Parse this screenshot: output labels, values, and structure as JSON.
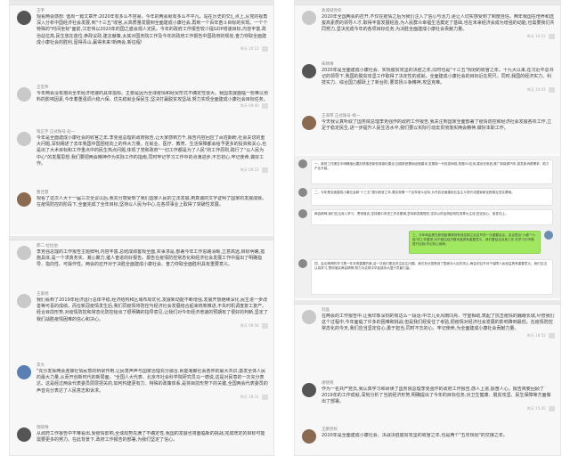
{
  "left": {
    "s1": {
      "items": [
        {
          "user": "王宇",
          "text": "观看两会感想:\n值周一篇文章开:2020年有多么不容易。今年的两会就有多么不平凡。站在历史的交汇点上,从党的视角深入分析中国经济社会发展,到\"十三五\"收官,从高质量发展到全面建成小康社会,再到一个百年奋斗目标的实现。一个个特殊的\"时间坐标\"面前,江宏伟以2020年的国之盛会观人定民。今年的政府工作报告较少提GDP增速目标,内容丰富,政治站位高,民生放在首位,参政议政,建言献策,太其对国务院工作及今年的政府工作报告中国政府的规划,奋力夺取全面建成小康社会的胜利,留得青山,赢得未来!新两会,新征程!",
          "time": "昨天 10:12"
        },
        {
          "user": "王宏伟",
          "text": "今年两会没有抱出全年经济增速的具体指标。主要是因为全球疫情和经贸形式不确定性很大。我国发展面临一些难以预料的影响因素,今年着重强调六稳六保。优先稳就业保民生,坚决打赢脱贫攻坚战,努力实现全面建成小康社会目标任务。",
          "time": "昨天 09:40"
        },
        {
          "user": "钱正宇 正式账号·赵一",
          "text": "今年是全面建成小康社会的收官之年,李克强总理的政府报告,让大家感到万千,报告内容回应了百姓期盼,社会关切的重大问题,深刻阐述了去年我国中国团结向上的伟大力量。在就业、医疗、教育、生活保障都会给予更多的投资和关心,也是出了大术目标和工作重点中的民生热点问题,体现了党和政府\"一切工作都是为了人民\"的工作原则,践行了\"以人民为中心\"的发展思想,我们要把两会精神作为实际工作的指南,同时牢记学习工作中的点滴进步,不忘初心,牢记使命,做好工作。",
          "time": "昨天 09:12"
        },
        {
          "user": "曹佳慧",
          "text": "观看了这次人大十一届三次全议以后,我充分感受到了我们国家人民的立法发展,用真诚的文字证明了国家的发展成就。在疫情防控的阶段下,全面完成了全年目标,坚持以人民为中心,在各项事业上取得了突破性发展。",
          "time": ""
        }
      ]
    },
    "s2": {
      "items": [
        {
          "user": "郝二·拉拉伯",
          "text": "李克强总理的工作报告主题鲜明,内容丰富,总结成绩客观全面,实事求是,部署今年工作思路清晰,立意高远,目标明确,措施具体,是一个求真务实、凝心聚力,催人奋进的好报告。报告在疫情防控常态化和经济社会发展工作中提出了明确指导、指向性、可操作性。两会的召开对于决胜全面建成小康社会、奋力夺取全面胜利具有重要意义。",
          "time": ""
        },
        {
          "user": "王家杨",
          "text": "我们看到了2019年经济运行总体平稳,经济结构和区域布局优化,发展新动能不断增强,发展开放继续深化,民生进一步改善等可喜的成绩。而在新冠疫情发生后,我们同疫情将防控与经济社会发展结合起来统筹推进,不失时机调度复工复产。经合目前形势,对疫情防控和常态化防控给出了很明确的指导意见,让我们对今年经济增速的预期有了很好的判断,坚定了我们战胜疫情困难的信心和决心。",
          "time": "昨天 09:56"
        },
        {
          "user": "李大",
          "text": "\"充分发挥两会连接社情民意的桥梁作用,让民意声声与国家治理充分融合,就能凝聚社会各界的最大共识,激发全体人民的最大力量,从而开创新时代的新局面。\"全国人大代表、北京市社会科学院研究员马一德说,这是对民意的一次充分表达。这是经过两会代表委员层层把关的,如何构建更有力、特殊的政策体系,是将目前形势下的关键,全国两会代表委员的声音充分表达了人民意志和诉求。",
          "time": "昨天 18:31"
        },
        {
          "user": "钱晓晴",
          "text": "从政府工作报告中不难看出,受疫情影响,全球局势充满了不确定性,我国的发展也将面临新的挑战,完成既定的目标可能需要更多的努力。在此背景下,政府工作报告的部署,为我们坚定了信心。",
          "time": ""
        }
      ]
    }
  },
  "right": {
    "s1": {
      "items": [
        {
          "user": "袁城城党校",
          "text": "2020年全国两会的召开,不仅在疫情之后为我们注入了信心与活力,更让人切实感受到了制度自信。两年我国在培养和选拔高素质的领导人才,取得丰富发展经验,为人民群众幸福生活奠定了基础,也在未来经济会成为增强的动能,也需要我们共同努力,坚决完成今年的各项目标任务,为决胜全面建成小康社会贡献力量。",
          "time": "昨天 10:12"
        },
        {
          "user": "朱晴晴",
          "text": "2020年是全面建成小康社会、实现脱贫攻坚的决胜之年,同时也是\"十三五\"规划的收官之年。十九大以来,在习近平总书记的领导下,我国的脱贫攻坚工作取得了决定性的成就。全面建成小康社会的目标近在咫尺。同时,我国的经济实力、科技实力、综合国力都跃上了新台阶,要发扬斗争精神,攻坚克难。",
          "time": "昨天 10:03"
        },
        {
          "user": "王海琴 正式账号·杨一",
          "text": "今天我认真听取了国务院总理李克强作的政府工作报告,我关注到国家全面部署了疫情防控和经济社会发展各项工作,立足于稳定民生,进一步提升人民生活水平,我们要以实际行动去贯彻落实两会精神,做好本职工作。",
          "time": ""
        }
      ]
    },
    "chat": {
      "items": [
        {
          "text": "一、政府工作报告中明确指出要加快推进新型城镇化建设,加强新型基础设施建设,发展新一代信息网络,拓展5G应用,建设充电桩,推广新能源汽车,激发新消费需求、助力产业升级。",
          "align": "left"
        },
        {
          "text": "二、今年是全面建成小康社会和\"十三五\"规划收官之年,要实现第一个百年奋斗目标,为开启全面建设社会主义现代化国家新征程奠定坚实基础。",
          "align": "left"
        },
        {
          "text": "两会精神,我们应当深入学习、贯彻落实,坚持稳中求进工作总基调,坚持新发展理念,坚持以供给侧结构性改革为主线,坚定信心、奋发向上。",
          "align": "left"
        },
        {
          "text": "三、今年两会是在新冠疫情得到有效控制之后召开的一次重要会议。会议提出\"六稳\"\"六保\"的工作要求,对于稳住经济基本盘具有重要意义。我们要结合自身工作,在学习中不断提升自我,牢记初心使命。",
          "align": "right",
          "green": true
        },
        {
          "text": "四、会议精神的学习是一件非常重要的事,这一次我们更加关注民生问题。我们充分感受到了国家对人民的关心,两会的召开对于保障人民权益具有重要意义。我们应当认真学习,贯彻落实两会精神,努力为实现中华民族伟大复兴贡献力量。",
          "align": "left"
        }
      ]
    },
    "s2": {
      "items": [
        {
          "user": "刘晶",
          "text": "在两会的工作报告中,让我印象深刻的有这么一段话:中华儿女风雨同舟、守望相助,筑起了抗击疫情的巍峨长城,尽管我们这个过程中,今年面临了许多的困难和挑战,但是我们经受住了考验,把疫情对经济社会发展的影响降到最低。在疫情防控常态化的今天,我们应当坚定信心,勇于担当,同时不忘初心、牢记使命,为全面建成小康社会贡献力量。",
          "time": "昨天 18:52"
        },
        {
          "user": "谢晓晓",
          "text": "作为一名共产党员,我认真学习和研读了国务院总理李克强作的政府工作报告,感人上进,振奋人心。报告简要回顾了2019年的工作成就,深刻分析了当前经济形势,明确提出了今年的目标任务,对卫生健康、脱贫攻坚、民生保障等方面做出了部署。",
          "time": "昨天 15:20"
        },
        {
          "user": "王鹏党校",
          "text": "2020年是全面建成小康社会、决战决胜脱贫攻坚的收官之年,也是两个\"五年规划\"的交接之年。",
          "time": ""
        }
      ]
    }
  }
}
